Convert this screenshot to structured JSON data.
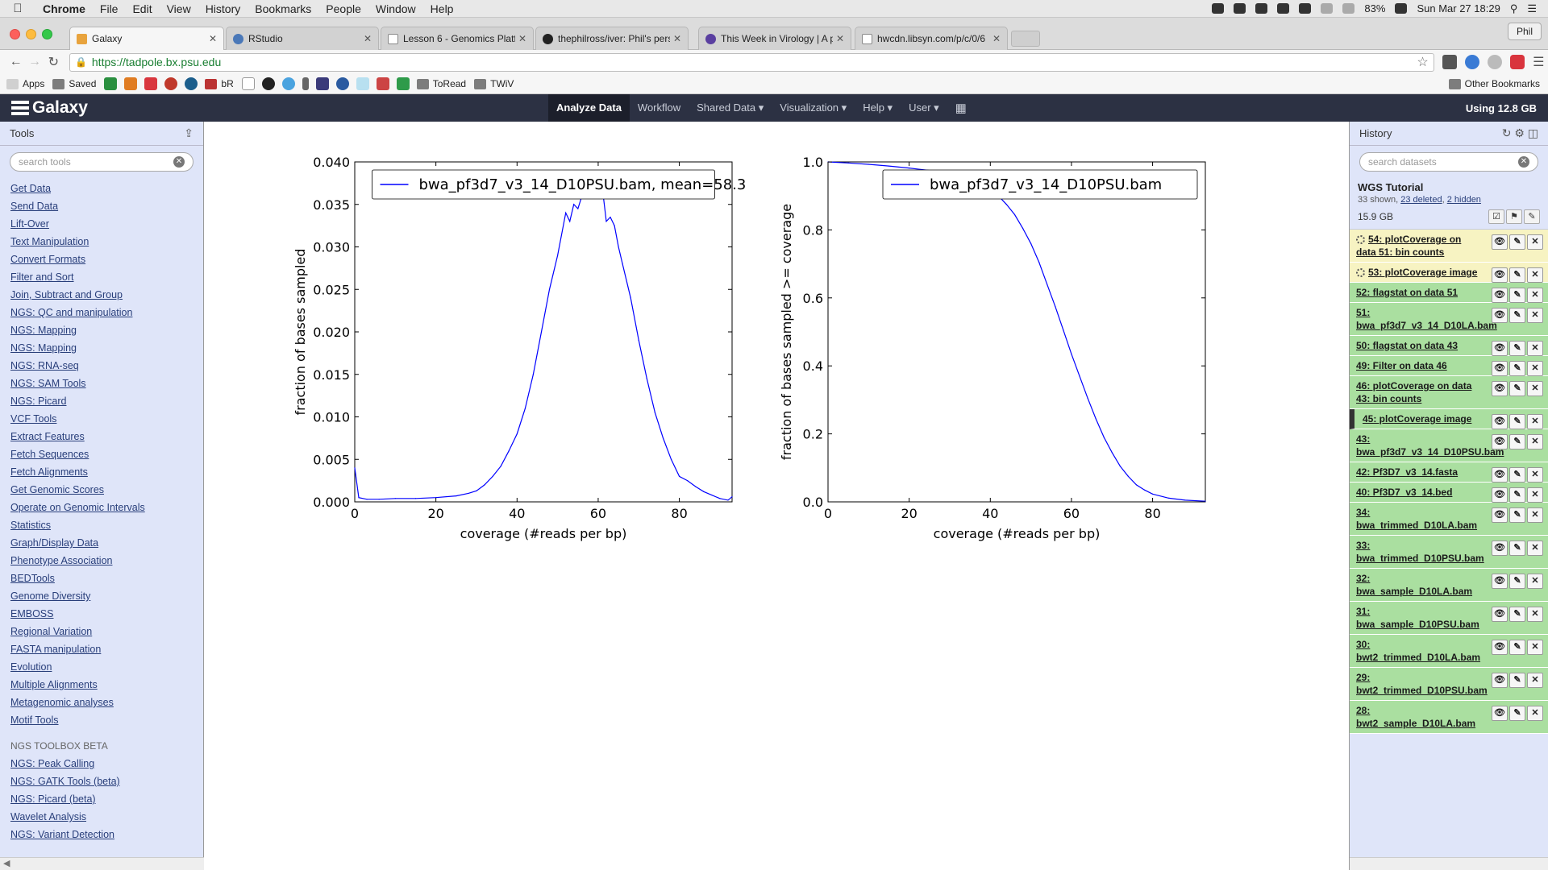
{
  "menubar": {
    "app": "Chrome",
    "items": [
      "File",
      "Edit",
      "View",
      "History",
      "Bookmarks",
      "People",
      "Window",
      "Help"
    ],
    "battery": "83%",
    "datetime": "Sun Mar 27  18:29"
  },
  "tabs": [
    {
      "title": "Galaxy",
      "active": true
    },
    {
      "title": "RStudio"
    },
    {
      "title": "Lesson 6 - Genomics Platf"
    },
    {
      "title": "thephilross/iver: Phil's pers"
    },
    {
      "title": "This Week in Virology | A p"
    },
    {
      "title": "hwcdn.libsyn.com/p/c/0/6"
    }
  ],
  "profile": "Phil",
  "address": {
    "url": "https://tadpole.bx.psu.edu"
  },
  "bookmarks": {
    "apps": "Apps",
    "saved": "Saved",
    "br": "bR",
    "toread": "ToRead",
    "twiv": "TWiV",
    "other": "Other Bookmarks"
  },
  "masthead": {
    "brand": "Galaxy",
    "nav": [
      "Analyze Data",
      "Workflow",
      "Shared Data",
      "Visualization",
      "Help",
      "User"
    ],
    "quota": "Using 12.8 GB"
  },
  "tool_panel": {
    "title": "Tools",
    "search_placeholder": "search tools",
    "tools": [
      "Get Data",
      "Send Data",
      "Lift-Over",
      "Text Manipulation",
      "Convert Formats",
      "Filter and Sort",
      "Join, Subtract and Group",
      "NGS: QC and manipulation",
      "NGS: Mapping",
      "NGS: Mapping",
      "NGS: RNA-seq",
      "NGS: SAM Tools",
      "NGS: Picard",
      "VCF Tools",
      "Extract Features",
      "Fetch Sequences",
      "Fetch Alignments",
      "Get Genomic Scores",
      "Operate on Genomic Intervals",
      "Statistics",
      "Graph/Display Data",
      "Phenotype Association",
      "BEDTools",
      "Genome Diversity",
      "EMBOSS",
      "Regional Variation",
      "FASTA manipulation",
      "Evolution",
      "Multiple Alignments",
      "Metagenomic analyses",
      "Motif Tools"
    ],
    "section": "NGS TOOLBOX BETA",
    "section_tools": [
      "NGS: Peak Calling",
      "NGS: GATK Tools (beta)",
      "NGS: Picard (beta)",
      "Wavelet Analysis",
      "NGS: Variant Detection"
    ]
  },
  "history": {
    "title": "History",
    "search_placeholder": "search datasets",
    "name": "WGS Tutorial",
    "shown": "33 shown, ",
    "deleted": "23 deleted",
    "sep": ", ",
    "hidden": "2 hidden",
    "size": "15.9 GB",
    "datasets": [
      {
        "label": "54: plotCoverage on data 51: bin counts",
        "state": "queued"
      },
      {
        "label": "53: plotCoverage image",
        "state": "queued"
      },
      {
        "label": "52: flagstat on data 51",
        "state": "ok"
      },
      {
        "label": "51: bwa_pf3d7_v3_14_D10LA.bam",
        "state": "ok"
      },
      {
        "label": "50: flagstat on data 43",
        "state": "ok"
      },
      {
        "label": "49: Filter on data 46",
        "state": "ok"
      },
      {
        "label": "46: plotCoverage on data 43: bin counts",
        "state": "ok"
      },
      {
        "label": "45: plotCoverage image",
        "state": "current"
      },
      {
        "label": "43: bwa_pf3d7_v3_14_D10PSU.bam",
        "state": "ok"
      },
      {
        "label": "42: Pf3D7_v3_14.fasta",
        "state": "ok"
      },
      {
        "label": "40: Pf3D7_v3_14.bed",
        "state": "ok"
      },
      {
        "label": "34: bwa_trimmed_D10LA.bam",
        "state": "ok"
      },
      {
        "label": "33: bwa_trimmed_D10PSU.bam",
        "state": "ok"
      },
      {
        "label": "32: bwa_sample_D10LA.bam",
        "state": "ok"
      },
      {
        "label": "31: bwa_sample_D10PSU.bam",
        "state": "ok"
      },
      {
        "label": "30: bwt2_trimmed_D10LA.bam",
        "state": "ok"
      },
      {
        "label": "29: bwt2_trimmed_D10PSU.bam",
        "state": "ok"
      },
      {
        "label": "28: bwt2_sample_D10LA.bam",
        "state": "ok"
      }
    ]
  },
  "chart_data": [
    {
      "type": "line",
      "xlabel": "coverage (#reads per bp)",
      "ylabel": "fraction of bases sampled",
      "xlim": [
        0,
        93
      ],
      "ylim": [
        0,
        0.04
      ],
      "xticks": [
        0,
        20,
        40,
        60,
        80
      ],
      "yticks": [
        "0.000",
        "0.005",
        "0.010",
        "0.015",
        "0.020",
        "0.025",
        "0.030",
        "0.035",
        "0.040"
      ],
      "legend_position": "top",
      "color": "#0000ff",
      "series": [
        {
          "name": "bwa_pf3d7_v3_14_D10PSU.bam, mean=58.3",
          "x": [
            0,
            1,
            3,
            6,
            10,
            15,
            20,
            25,
            28,
            30,
            32,
            34,
            36,
            38,
            40,
            42,
            44,
            46,
            48,
            50,
            52,
            53,
            54,
            55,
            56,
            57,
            58,
            59,
            60,
            61,
            62,
            63,
            64,
            65,
            66,
            68,
            70,
            72,
            74,
            76,
            78,
            80,
            82,
            84,
            86,
            88,
            90,
            92,
            93
          ],
          "y": [
            0.004,
            0.0005,
            0.0003,
            0.0003,
            0.0004,
            0.0004,
            0.0005,
            0.0007,
            0.001,
            0.0013,
            0.002,
            0.003,
            0.0042,
            0.006,
            0.008,
            0.011,
            0.015,
            0.02,
            0.025,
            0.029,
            0.034,
            0.033,
            0.035,
            0.0345,
            0.036,
            0.0365,
            0.037,
            0.0365,
            0.036,
            0.037,
            0.033,
            0.0335,
            0.0325,
            0.03,
            0.028,
            0.024,
            0.019,
            0.0145,
            0.0105,
            0.0075,
            0.005,
            0.003,
            0.0025,
            0.0018,
            0.0012,
            0.0008,
            0.0004,
            0.0002,
            0.0006
          ]
        }
      ]
    },
    {
      "type": "line",
      "xlabel": "coverage (#reads per bp)",
      "ylabel": "fraction of bases sampled >= coverage",
      "xlim": [
        0,
        93
      ],
      "ylim": [
        0,
        1.0
      ],
      "xticks": [
        0,
        20,
        40,
        60,
        80
      ],
      "yticks": [
        "0.0",
        "0.2",
        "0.4",
        "0.6",
        "0.8",
        "1.0"
      ],
      "legend_position": "top-right",
      "color": "#0000ff",
      "series": [
        {
          "name": "bwa_pf3d7_v3_14_D10PSU.bam",
          "x": [
            0,
            5,
            10,
            15,
            20,
            25,
            30,
            35,
            38,
            40,
            42,
            44,
            46,
            48,
            50,
            52,
            54,
            56,
            58,
            60,
            62,
            64,
            66,
            68,
            70,
            72,
            74,
            76,
            78,
            80,
            84,
            88,
            93
          ],
          "y": [
            1.0,
            0.997,
            0.993,
            0.988,
            0.982,
            0.975,
            0.965,
            0.95,
            0.935,
            0.92,
            0.9,
            0.875,
            0.845,
            0.805,
            0.76,
            0.705,
            0.64,
            0.575,
            0.505,
            0.435,
            0.37,
            0.305,
            0.245,
            0.19,
            0.145,
            0.105,
            0.075,
            0.05,
            0.035,
            0.023,
            0.011,
            0.005,
            0.002
          ]
        }
      ]
    }
  ]
}
